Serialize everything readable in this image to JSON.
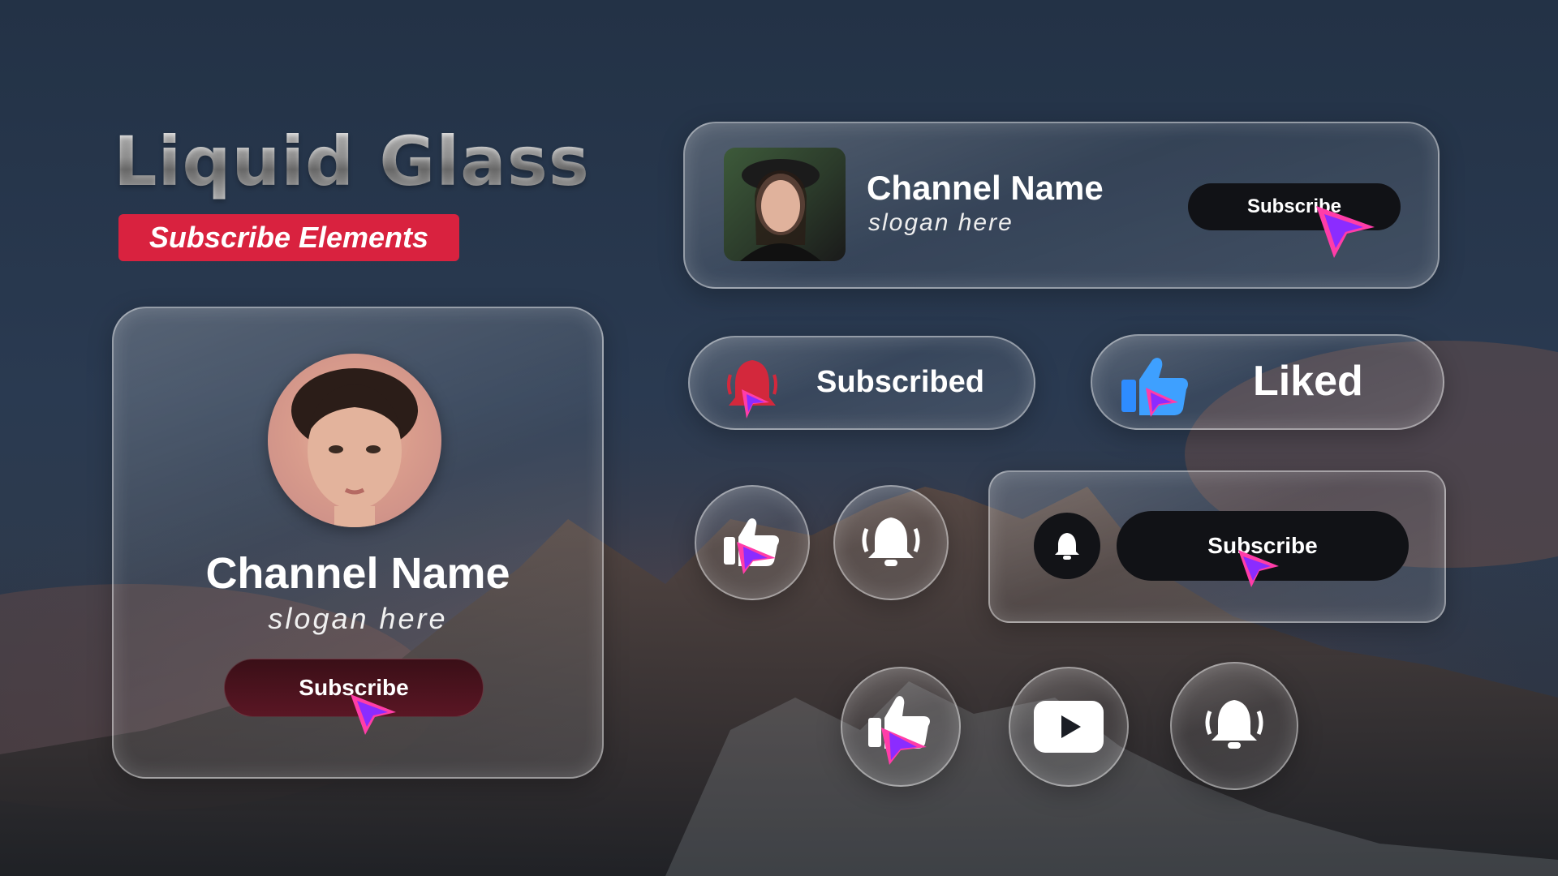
{
  "title": {
    "main": "Liquid Glass",
    "badge": "Subscribe Elements"
  },
  "card_left": {
    "channel_name": "Channel Name",
    "slogan": "slogan here",
    "button_label": "Subscribe"
  },
  "card_top": {
    "channel_name": "Channel Name",
    "slogan": "slogan here",
    "button_label": "Subscribe"
  },
  "pill_subscribed": {
    "label": "Subscribed",
    "icon": "bell-icon"
  },
  "pill_liked": {
    "label": "Liked",
    "icon": "thumbs-up-icon"
  },
  "bell_card": {
    "button_label": "Subscribe",
    "icon": "bell-icon"
  },
  "round_buttons": [
    {
      "icon": "thumbs-up-icon"
    },
    {
      "icon": "bell-ring-icon"
    },
    {
      "icon": "thumbs-up-icon"
    },
    {
      "icon": "play-icon"
    },
    {
      "icon": "bell-ring-icon"
    }
  ],
  "colors": {
    "badge": "#d9223f",
    "accent_pink": "#ff3da8",
    "accent_purple": "#7a2cff",
    "like_blue": "#2e8cff",
    "bell_red": "#d3283c"
  }
}
